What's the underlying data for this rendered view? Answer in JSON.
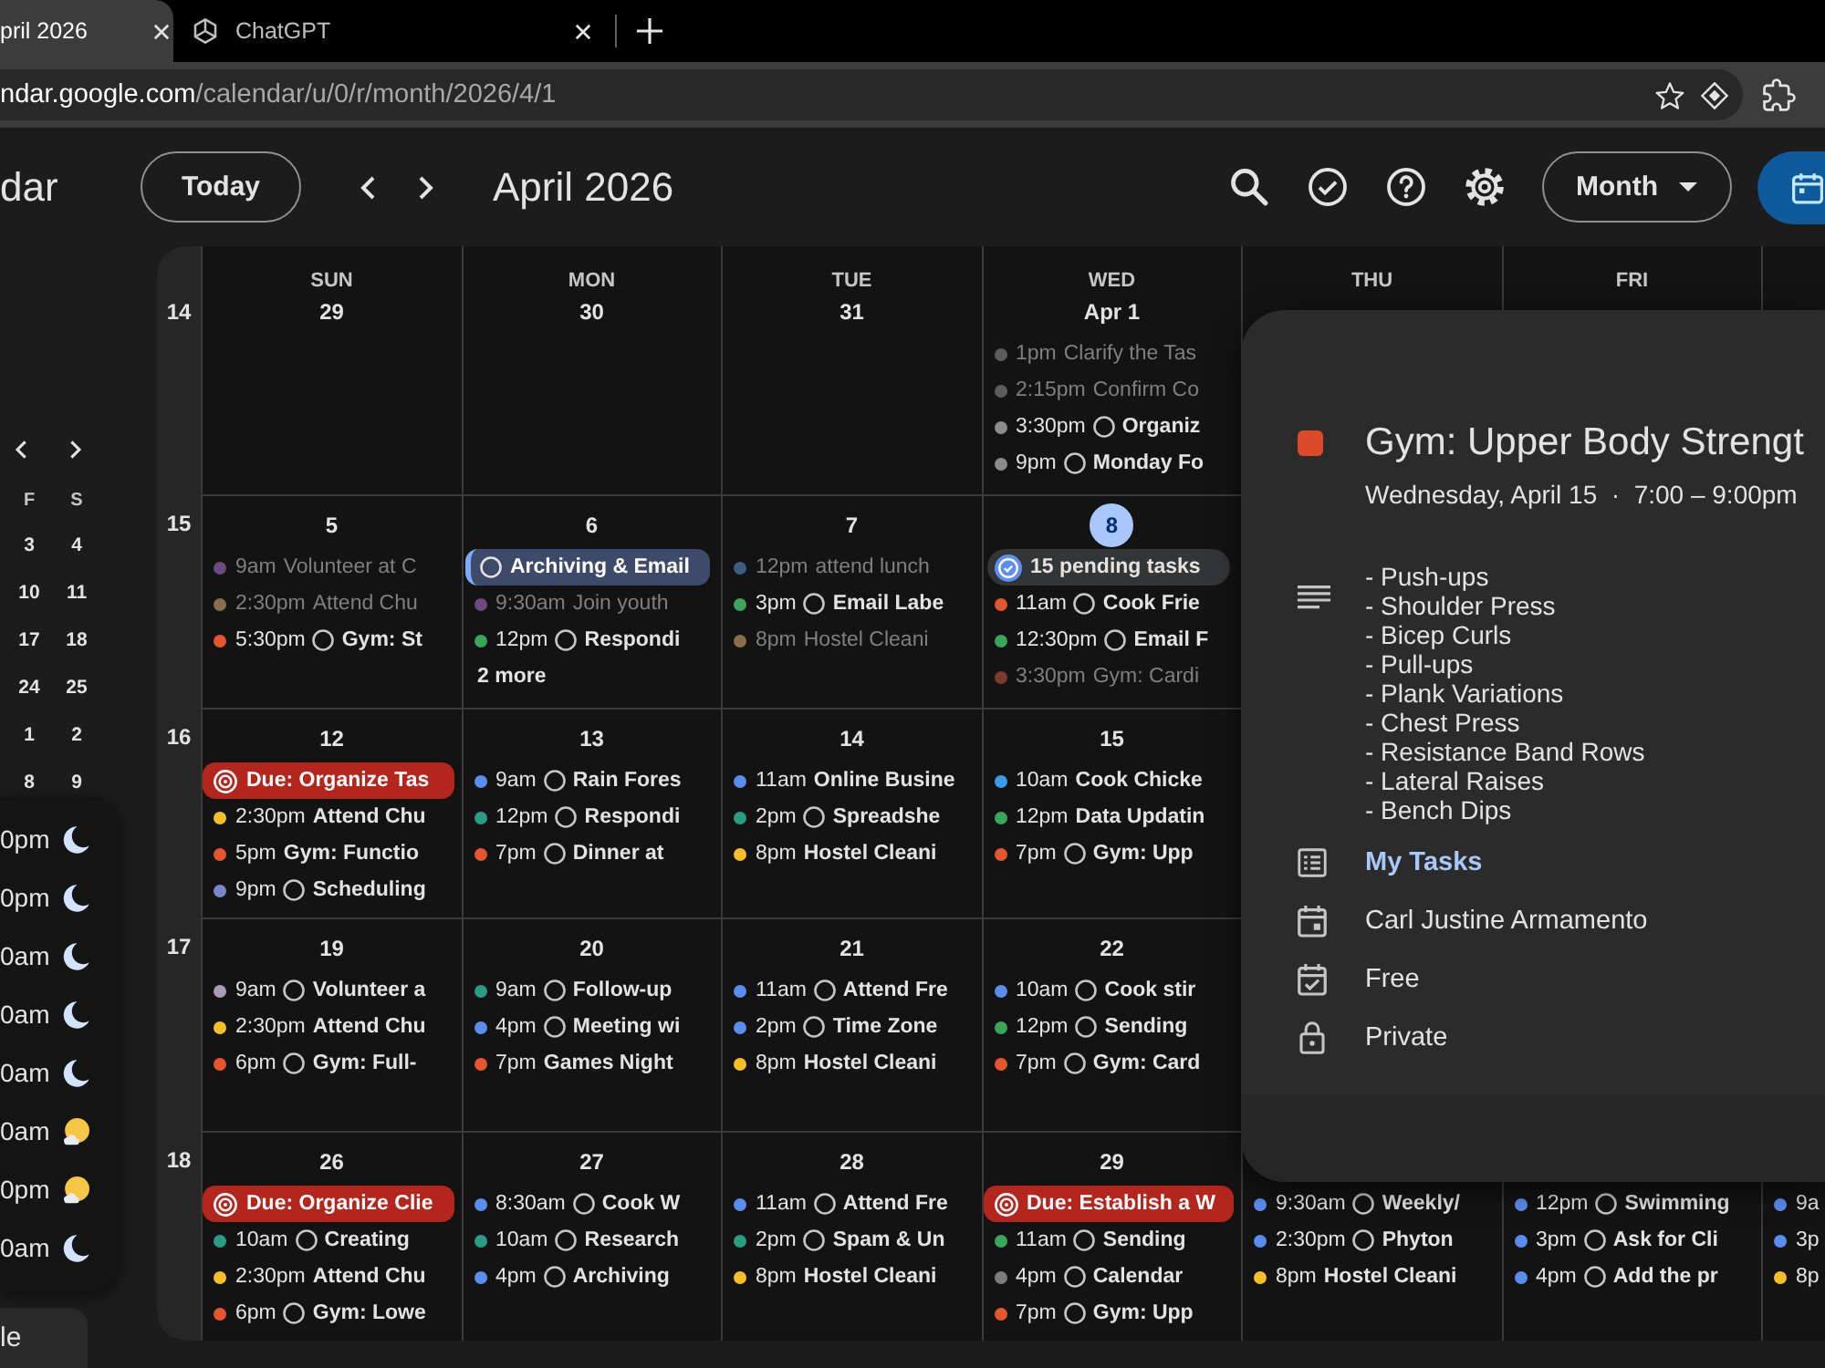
{
  "browser": {
    "tabs": [
      {
        "title": "pril 2026",
        "selected": true
      },
      {
        "title": "ChatGPT",
        "selected": false
      }
    ],
    "address": {
      "host": "ndar.google.com",
      "path": "/calendar/u/0/r/month/2026/4/1"
    }
  },
  "header": {
    "logo": "dar",
    "today": "Today",
    "period": "April 2026",
    "view": "Month"
  },
  "sidebar": {
    "mini_calendar": {
      "weekdays": [
        "F",
        "S"
      ],
      "weeks": [
        [
          "3",
          "4"
        ],
        [
          "10",
          "11"
        ],
        [
          "17",
          "18"
        ],
        [
          "24",
          "25"
        ],
        [
          "1",
          "2"
        ],
        [
          "8",
          "9"
        ]
      ]
    },
    "time_list": [
      {
        "time": "0pm",
        "kind": "moon"
      },
      {
        "time": "0pm",
        "kind": "moon"
      },
      {
        "time": "0am",
        "kind": "moon"
      },
      {
        "time": "0am",
        "kind": "moon"
      },
      {
        "time": "0am",
        "kind": "moon"
      },
      {
        "time": "0am",
        "kind": "sun"
      },
      {
        "time": "0pm",
        "kind": "sun"
      },
      {
        "time": "0am",
        "kind": "moon"
      }
    ],
    "button": "le"
  },
  "calendar": {
    "weekdays": [
      "SUN",
      "MON",
      "TUE",
      "WED",
      "THU",
      "FRI"
    ],
    "weeks": [
      {
        "number": "14",
        "days": [
          {
            "date": "29",
            "today": false
          },
          {
            "date": "30",
            "today": false
          },
          {
            "date": "31",
            "today": false
          },
          {
            "date": "Apr 1",
            "today": false,
            "events": [
              {
                "kind": "event",
                "time": "1pm",
                "title": "Clarify the Tas",
                "color": "#5c5c5c",
                "faded": true
              },
              {
                "kind": "event",
                "time": "2:15pm",
                "title": "Confirm Co",
                "color": "#5c5c5c",
                "faded": true
              },
              {
                "kind": "task",
                "time": "3:30pm",
                "title": "Organiz",
                "color": "#8c8c8c",
                "faded": false
              },
              {
                "kind": "task",
                "time": "9pm",
                "title": "Monday Fo",
                "color": "#8c8c8c",
                "faded": false
              }
            ]
          }
        ]
      },
      {
        "number": "15",
        "days": [
          {
            "date": "5",
            "today": false,
            "events": [
              {
                "kind": "event",
                "time": "9am",
                "title": "Volunteer at C",
                "color": "#6d4a7e",
                "faded": true
              },
              {
                "kind": "event",
                "time": "2:30pm",
                "title": "Attend Chu",
                "color": "#86704b",
                "faded": true
              },
              {
                "kind": "task",
                "time": "5:30pm",
                "title": "Gym: St",
                "color": "#e4572e",
                "faded": false
              }
            ]
          },
          {
            "date": "6",
            "today": false,
            "events": [
              {
                "kind": "task_chip",
                "title": "Archiving & Email",
                "faded": false
              },
              {
                "kind": "event",
                "time": "9:30am",
                "title": "Join youth",
                "color": "#6d4a7e",
                "faded": true
              },
              {
                "kind": "task",
                "time": "12pm",
                "title": "Respondi",
                "color": "#3ba55c",
                "faded": false
              },
              {
                "kind": "more",
                "title": "2 more",
                "faded": false
              }
            ]
          },
          {
            "date": "7",
            "today": false,
            "events": [
              {
                "kind": "event",
                "time": "12pm",
                "title": "attend lunch",
                "color": "#3f5e7e",
                "faded": true
              },
              {
                "kind": "task",
                "time": "3pm",
                "title": "Email Labe",
                "color": "#3ba55c",
                "faded": false
              },
              {
                "kind": "event",
                "time": "8pm",
                "title": "Hostel Cleani",
                "color": "#86704b",
                "faded": true
              }
            ]
          },
          {
            "date": "8",
            "today": true,
            "events": [
              {
                "kind": "pending",
                "title": "15 pending tasks",
                "faded": false
              },
              {
                "kind": "task",
                "time": "11am",
                "title": "Cook Frie",
                "color": "#e4572e",
                "faded": false
              },
              {
                "kind": "task",
                "time": "12:30pm",
                "title": "Email F",
                "color": "#3ba55c",
                "faded": false
              },
              {
                "kind": "event",
                "time": "3:30pm",
                "title": "Gym: Cardi",
                "color": "#7a3a2c",
                "faded": true
              }
            ]
          }
        ]
      },
      {
        "number": "16",
        "days": [
          {
            "date": "12",
            "today": false,
            "events": [
              {
                "kind": "due",
                "title": "Due: Organize Tas",
                "faded": false
              },
              {
                "kind": "event",
                "time": "2:30pm",
                "title": "Attend Chu",
                "color": "#f6bf26",
                "faded": false
              },
              {
                "kind": "event",
                "time": "5pm",
                "title": "Gym: Functio",
                "color": "#e4572e",
                "faded": false
              },
              {
                "kind": "task",
                "time": "9pm",
                "title": "Scheduling",
                "color": "#7986cb",
                "faded": false
              }
            ]
          },
          {
            "date": "13",
            "today": false,
            "events": [
              {
                "kind": "task",
                "time": "9am",
                "title": "Rain Fores",
                "color": "#5b8def",
                "faded": false
              },
              {
                "kind": "task",
                "time": "12pm",
                "title": "Respondi",
                "color": "#2b9c80",
                "faded": false
              },
              {
                "kind": "task",
                "time": "7pm",
                "title": "Dinner at",
                "color": "#e4572e",
                "faded": false
              }
            ]
          },
          {
            "date": "14",
            "today": false,
            "events": [
              {
                "kind": "event",
                "time": "11am",
                "title": "Online Busine",
                "color": "#5b8def",
                "faded": false
              },
              {
                "kind": "task",
                "time": "2pm",
                "title": "Spreadshe",
                "color": "#2b9c80",
                "faded": false
              },
              {
                "kind": "event",
                "time": "8pm",
                "title": "Hostel Cleani",
                "color": "#f6bf26",
                "faded": false
              }
            ]
          },
          {
            "date": "15",
            "today": false,
            "events": [
              {
                "kind": "event",
                "time": "10am",
                "title": "Cook Chicke",
                "color": "#3b9be6",
                "faded": false
              },
              {
                "kind": "event",
                "time": "12pm",
                "title": "Data Updatin",
                "color": "#3ba55c",
                "faded": false
              },
              {
                "kind": "task",
                "time": "7pm",
                "title": "Gym: Upp",
                "color": "#e4572e",
                "faded": false
              }
            ]
          }
        ]
      },
      {
        "number": "17",
        "days": [
          {
            "date": "19",
            "today": false,
            "events": [
              {
                "kind": "task",
                "time": "9am",
                "title": "Volunteer a",
                "color": "#a79bb8",
                "faded": false
              },
              {
                "kind": "event",
                "time": "2:30pm",
                "title": "Attend Chu",
                "color": "#f6bf26",
                "faded": false
              },
              {
                "kind": "task",
                "time": "6pm",
                "title": "Gym: Full-",
                "color": "#e4572e",
                "faded": false
              }
            ]
          },
          {
            "date": "20",
            "today": false,
            "events": [
              {
                "kind": "task",
                "time": "9am",
                "title": "Follow-up",
                "color": "#2b9c80",
                "faded": false
              },
              {
                "kind": "task",
                "time": "4pm",
                "title": "Meeting wi",
                "color": "#5b8def",
                "faded": false
              },
              {
                "kind": "event",
                "time": "7pm",
                "title": "Games Night",
                "color": "#e4572e",
                "faded": false
              }
            ]
          },
          {
            "date": "21",
            "today": false,
            "events": [
              {
                "kind": "task",
                "time": "11am",
                "title": "Attend Fre",
                "color": "#5b8def",
                "faded": false
              },
              {
                "kind": "task",
                "time": "2pm",
                "title": "Time Zone",
                "color": "#5b8def",
                "faded": false
              },
              {
                "kind": "event",
                "time": "8pm",
                "title": "Hostel Cleani",
                "color": "#f6bf26",
                "faded": false
              }
            ]
          },
          {
            "date": "22",
            "today": false,
            "events": [
              {
                "kind": "task",
                "time": "10am",
                "title": "Cook stir",
                "color": "#5b8def",
                "faded": false
              },
              {
                "kind": "task",
                "time": "12pm",
                "title": "Sending",
                "color": "#3ba55c",
                "faded": false
              },
              {
                "kind": "task",
                "time": "7pm",
                "title": "Gym: Card",
                "color": "#e4572e",
                "faded": false
              }
            ]
          }
        ]
      },
      {
        "number": "18",
        "days": [
          {
            "date": "26",
            "today": false,
            "events": [
              {
                "kind": "due",
                "title": "Due: Organize Clie",
                "faded": false
              },
              {
                "kind": "task",
                "time": "10am",
                "title": "Creating",
                "color": "#2b9c80",
                "faded": false
              },
              {
                "kind": "event",
                "time": "2:30pm",
                "title": "Attend Chu",
                "color": "#f6bf26",
                "faded": false
              },
              {
                "kind": "task",
                "time": "6pm",
                "title": "Gym: Lowe",
                "color": "#e4572e",
                "faded": false
              }
            ]
          },
          {
            "date": "27",
            "today": false,
            "events": [
              {
                "kind": "task",
                "time": "8:30am",
                "title": "Cook W",
                "color": "#5b8def",
                "faded": false
              },
              {
                "kind": "task",
                "time": "10am",
                "title": "Research",
                "color": "#2b9c80",
                "faded": false
              },
              {
                "kind": "task",
                "time": "4pm",
                "title": "Archiving",
                "color": "#5b8def",
                "faded": false
              }
            ]
          },
          {
            "date": "28",
            "today": false,
            "events": [
              {
                "kind": "task",
                "time": "11am",
                "title": "Attend Fre",
                "color": "#5b8def",
                "faded": false
              },
              {
                "kind": "task",
                "time": "2pm",
                "title": "Spam & Un",
                "color": "#2b9c80",
                "faded": false
              },
              {
                "kind": "event",
                "time": "8pm",
                "title": "Hostel Cleani",
                "color": "#f6bf26",
                "faded": false
              }
            ]
          },
          {
            "date": "29",
            "today": false,
            "events": [
              {
                "kind": "due",
                "title": "Due: Establish a W",
                "faded": false
              },
              {
                "kind": "task",
                "time": "11am",
                "title": "Sending",
                "color": "#3ba55c",
                "faded": false
              },
              {
                "kind": "task",
                "time": "4pm",
                "title": "Calendar",
                "color": "#7c7c7c",
                "faded": false
              },
              {
                "kind": "task",
                "time": "7pm",
                "title": "Gym: Upp",
                "color": "#e4572e",
                "faded": false
              }
            ]
          },
          {
            "today": false,
            "events": [
              {
                "kind": "task",
                "time": "9:30am",
                "title": "Weekly/",
                "color": "#5b8def",
                "faded": false
              },
              {
                "kind": "task",
                "time": "2:30pm",
                "title": "Phyton",
                "color": "#5b8def",
                "faded": false
              },
              {
                "kind": "event",
                "time": "8pm",
                "title": "Hostel Cleani",
                "color": "#f6bf26",
                "faded": false
              }
            ]
          },
          {
            "today": false,
            "events": [
              {
                "kind": "task",
                "time": "12pm",
                "title": "Swimming",
                "color": "#5b8def",
                "faded": false
              },
              {
                "kind": "task",
                "time": "3pm",
                "title": "Ask for Cli",
                "color": "#5b8def",
                "faded": false
              },
              {
                "kind": "task",
                "time": "4pm",
                "title": "Add the pr",
                "color": "#5b8def",
                "faded": false
              }
            ]
          },
          {
            "today": false,
            "events": [
              {
                "kind": "event",
                "time": "9a",
                "color": "#5b8def",
                "faded": false
              },
              {
                "kind": "event",
                "time": "3p",
                "color": "#5b8def",
                "faded": false
              },
              {
                "kind": "event",
                "time": "8p",
                "color": "#f6bf26",
                "faded": false
              }
            ]
          }
        ]
      }
    ]
  },
  "event_popup": {
    "title": "Gym: Upper Body Strengt",
    "when": "Wednesday, April 15  ·  7:00 – 9:00pm",
    "description": [
      "- Push-ups",
      "- Shoulder Press",
      "- Bicep Curls",
      "- Pull-ups",
      "- Plank Variations",
      "- Chest Press",
      "- Resistance Band Rows",
      "- Lateral Raises",
      "- Bench Dips"
    ],
    "details": [
      {
        "kind": "tasks",
        "text": "My Tasks"
      },
      {
        "kind": "calendar",
        "text": "Carl Justine Armamento"
      },
      {
        "kind": "availability",
        "text": "Free"
      },
      {
        "kind": "visibility",
        "text": "Private"
      }
    ]
  }
}
